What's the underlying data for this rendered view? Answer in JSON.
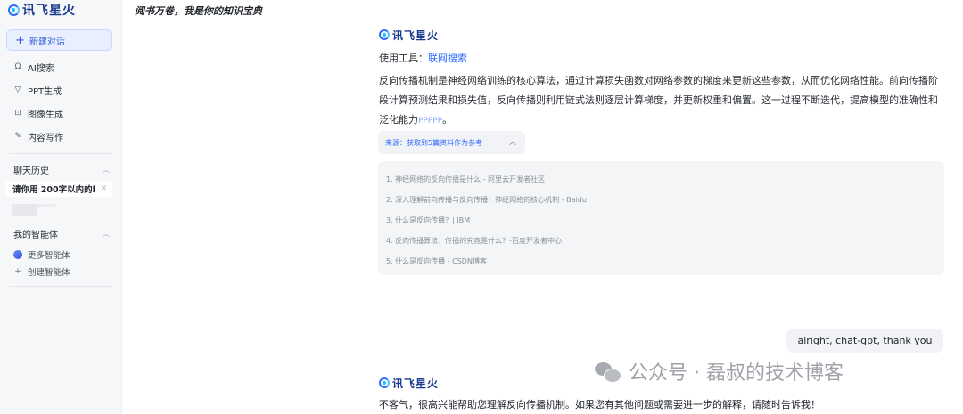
{
  "brand": {
    "name": "讯飞星火"
  },
  "sidebar": {
    "new_chat_label": "新建对话",
    "menu": [
      {
        "icon": "ai-search-icon",
        "glyph": "Ω",
        "label": "AI搜索"
      },
      {
        "icon": "ppt-icon",
        "glyph": "▽",
        "label": "PPT生成"
      },
      {
        "icon": "image-icon",
        "glyph": "⊡",
        "label": "图像生成"
      },
      {
        "icon": "writing-icon",
        "glyph": "✎",
        "label": "内容写作"
      }
    ],
    "history_title": "聊天历史",
    "history_items": [
      "请你用 200字以内的l"
    ],
    "agents_title": "我的智能体",
    "agents": [
      {
        "icon": "more-agents-icon",
        "label": "更多智能体"
      },
      {
        "icon": "create-agent-icon",
        "glyph": "+",
        "label": "创建智能体"
      }
    ]
  },
  "header": {
    "title": "阅书万卷，我是你的知识宝典"
  },
  "conversation": {
    "bot_name": "讯飞星火",
    "tools_label": "使用工具：",
    "tools_link": "联网搜索",
    "answer_text": "反向传播机制是神经网络训练的核心算法，通过计算损失函数对网络参数的梯度来更新这些参数，从而优化网络性能。前向传播阶段计算预测结果和损失值，反向传播则利用链式法则逐层计算梯度，并更新权重和偏置。这一过程不断迭代，提高模型的准确性和泛化能力",
    "answer_tail": "PPPPP",
    "answer_end": "。",
    "sources_label": "来源：获取到5篇资料作为参考",
    "sources": [
      "1. 神经网络的反向传播是什么 - 阿里云开发者社区",
      "2. 深入理解前向传播与反向传播：神经网络的核心机制 - Baidu",
      "3. 什么是反向传播？| IBM",
      "4. 反向传播算法：传播的究竟是什么？-百度开发者中心",
      "5. 什么是反向传播 - CSDN博客"
    ],
    "user_message": "alright,  chat-gpt, thank you",
    "reply_text": "不客气，很高兴能帮助您理解反向传播机制。如果您有其他问题或需要进一步的解释，请随时告诉我！"
  },
  "watermark": {
    "text": "公众号 · 磊叔的技术博客"
  }
}
